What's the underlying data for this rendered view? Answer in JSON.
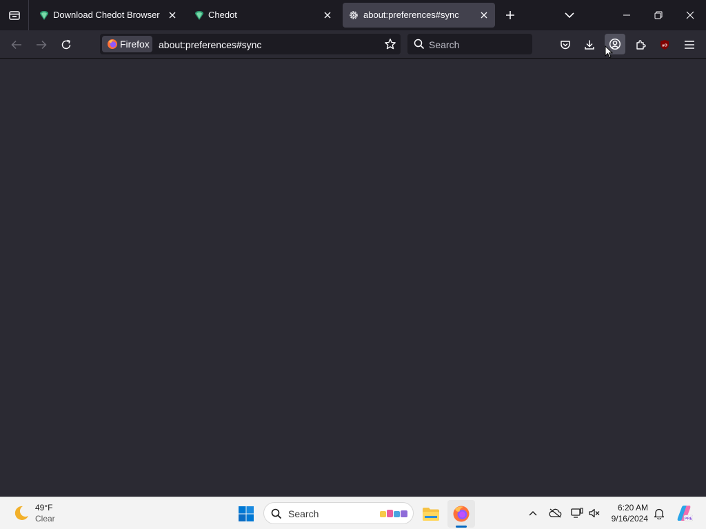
{
  "tabs": [
    {
      "title": "Download Chedot Browser",
      "active": false
    },
    {
      "title": "Chedot",
      "active": false
    },
    {
      "title": "about:preferences#sync",
      "active": true
    }
  ],
  "navbar": {
    "identity_label": "Firefox",
    "url": "about:preferences#sync",
    "search_placeholder": "Search"
  },
  "taskbar": {
    "weather_temp": "49°F",
    "weather_desc": "Clear",
    "search_placeholder": "Search",
    "time": "6:20 AM",
    "date": "9/16/2024"
  },
  "colors": {
    "chrome_bg": "#1c1b22",
    "toolbar_bg": "#2b2a33",
    "active_tab": "#42414d",
    "taskbar_bg": "#f3f3f3",
    "accent_blue": "#0067c0"
  },
  "icons": [
    "tab-overview-icon",
    "chedot-favicon",
    "gear-icon",
    "close-icon",
    "plus-icon",
    "chevron-down-icon",
    "minimize-icon",
    "restore-icon",
    "back-arrow-icon",
    "forward-arrow-icon",
    "reload-icon",
    "firefox-icon",
    "star-icon",
    "search-icon",
    "pocket-icon",
    "download-icon",
    "account-icon",
    "extensions-icon",
    "ublock-icon",
    "hamburger-menu-icon",
    "moon-icon",
    "windows-start-icon",
    "file-explorer-icon",
    "firefox-taskbar-icon",
    "chevron-up-icon",
    "onedrive-icon",
    "network-icon",
    "volume-icon",
    "bell-icon",
    "copilot-icon"
  ]
}
